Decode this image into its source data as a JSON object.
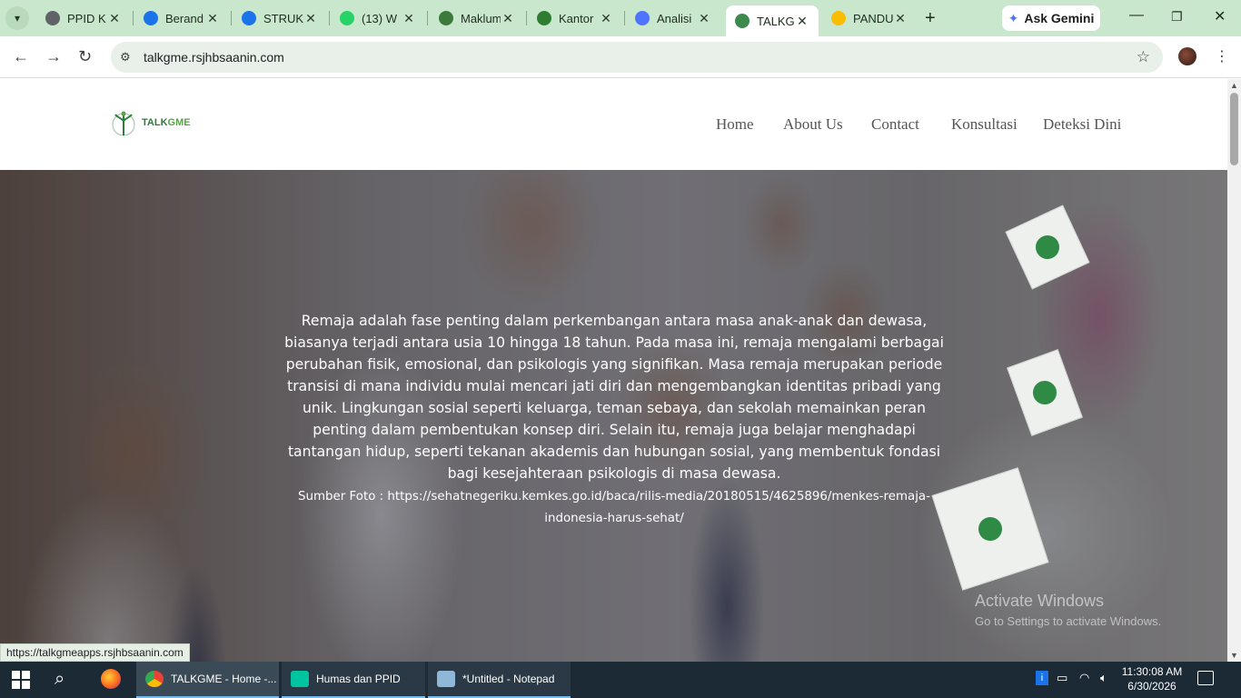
{
  "browser": {
    "tabs": [
      {
        "title": "PPID K",
        "favicon_color": "#5f6368"
      },
      {
        "title": "Berand",
        "favicon_color": "#1a73e8"
      },
      {
        "title": "STRUK",
        "favicon_color": "#1a73e8"
      },
      {
        "title": "(13) W",
        "favicon_color": "#25d366"
      },
      {
        "title": "Maklum",
        "favicon_color": "#3c7a3c"
      },
      {
        "title": "Kantor",
        "favicon_color": "#2e7d32"
      },
      {
        "title": "Analisi",
        "favicon_color": "#4e74ff"
      },
      {
        "title": "TALKGI",
        "favicon_color": "#3d8a4e",
        "active": true
      },
      {
        "title": "PANDU",
        "favicon_color": "#fbbc04"
      }
    ],
    "new_tab_label": "+",
    "ask_gemini_label": "Ask Gemini",
    "url": "talkgme.rsjhbsaanin.com",
    "status_url": "https://talkgmeapps.rsjhbsaanin.com"
  },
  "site": {
    "logo_text_talk": "TALK",
    "logo_text_gme": "GME",
    "nav": [
      {
        "label": "Home",
        "color": "#3d8a4e"
      },
      {
        "label": "About Us",
        "color": "#555555"
      },
      {
        "label": "Contact",
        "color": "#555555"
      },
      {
        "label": "Konsultasi",
        "color": "#555555"
      },
      {
        "label": "Deteksi Dini",
        "color": "#3d8a4e"
      }
    ],
    "hero": {
      "body": "Remaja adalah fase penting dalam perkembangan antara masa anak-anak dan dewasa, biasanya terjadi antara usia 10 hingga 18 tahun. Pada masa ini, remaja mengalami berbagai perubahan fisik, emosional, dan psikologis yang signifikan. Masa remaja merupakan periode transisi di mana individu mulai mencari jati diri dan mengembangkan identitas pribadi yang unik. Lingkungan sosial seperti keluarga, teman sebaya, dan sekolah memainkan peran penting dalam pembentukan konsep diri. Selain itu, remaja juga belajar menghadapi tantangan hidup, seperti tekanan akademis dan hubungan sosial, yang membentuk fondasi bagi kesejahteraan psikologis di masa dewasa.",
      "source": "Sumber Foto : https://sehatnegeriku.kemkes.go.id/baca/rilis-media/20180515/4625896/menkes-remaja-indonesia-harus-sehat/"
    }
  },
  "watermark": {
    "line1": "Activate Windows",
    "line2": "Go to Settings to activate Windows."
  },
  "taskbar": {
    "items": [
      {
        "label": "TALKGME - Home -...",
        "icon_color": "#4285f4"
      },
      {
        "label": "Humas dan PPID",
        "icon_color": "#00c4a0"
      },
      {
        "label": "*Untitled - Notepad",
        "icon_color": "#8fb8d8"
      }
    ],
    "time": "11:30:08 AM",
    "date": "6/30/2026"
  }
}
